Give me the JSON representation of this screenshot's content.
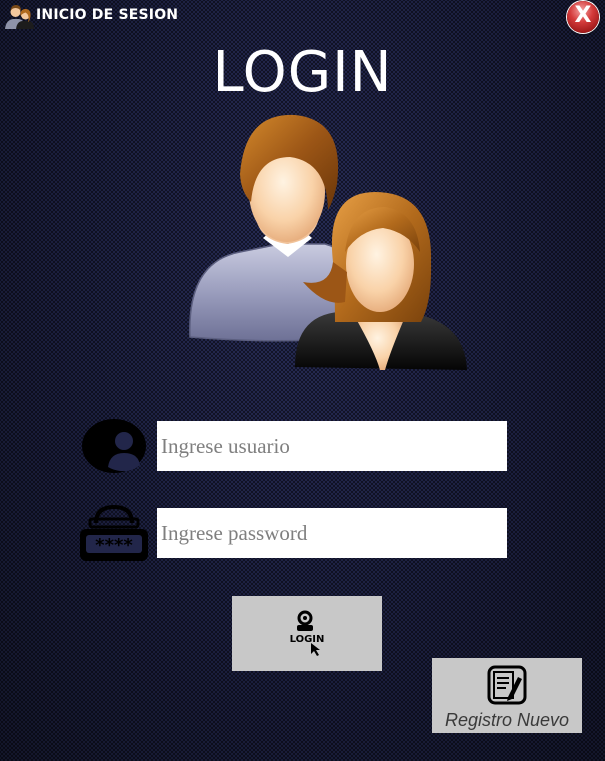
{
  "window": {
    "title": "INICIO DE SESION",
    "close_label": "X"
  },
  "main": {
    "heading": "LOGIN",
    "username_placeholder": "Ingrese usuario",
    "password_placeholder": "Ingrese password",
    "login_button_icon_text": "LOGIN",
    "register_label": "Registro Nuevo"
  },
  "icons": {
    "app": "users-icon",
    "close": "close-icon",
    "illustration": "users-illustration",
    "username": "user-circle-icon",
    "password": "password-lock-icon",
    "login": "login-icon",
    "register": "notepad-pencil-icon"
  },
  "colors": {
    "background": "#22264a",
    "close_button": "#c92f2f",
    "button_gray": "#c8c8c8",
    "text_white": "#ffffff"
  }
}
